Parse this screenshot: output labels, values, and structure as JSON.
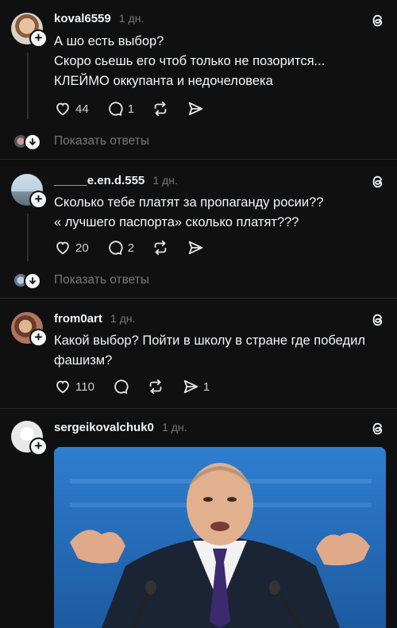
{
  "posts": [
    {
      "username": "koval6559",
      "time": "1 дн.",
      "lines": [
        "А шо есть выбор?",
        "Скоро сьешь его чтоб только не позорится...",
        "КЛЕЙМО оккупанта и недочеловека"
      ],
      "likes": "44",
      "comments": "1",
      "reposts": "",
      "shares": "",
      "replies_label": "Показать ответы"
    },
    {
      "username": "_____e.en.d.555",
      "time": "1 дн.",
      "lines": [
        "Сколько тебе платят за пропаганду росии??",
        "« лучшего паспорта» сколько платят???"
      ],
      "likes": "20",
      "comments": "2",
      "reposts": "",
      "shares": "",
      "replies_label": "Показать ответы"
    },
    {
      "username": "from0art",
      "time": "1 дн.",
      "lines": [
        "Какой выбор? Пойти в школу в стране где победил",
        "фашизм?"
      ],
      "likes": "110",
      "comments": "",
      "reposts": "",
      "shares": "1"
    },
    {
      "username": "sergeikovalchuk0",
      "time": "1 дн."
    }
  ],
  "icons": {
    "logo": "threads-logo-icon",
    "like": "heart-icon",
    "comment": "comment-icon",
    "repost": "repost-icon",
    "share": "share-icon",
    "follow": "plus-icon"
  },
  "colors": {
    "background": "#101010",
    "text": "#f3f5f7",
    "muted": "#777777"
  }
}
